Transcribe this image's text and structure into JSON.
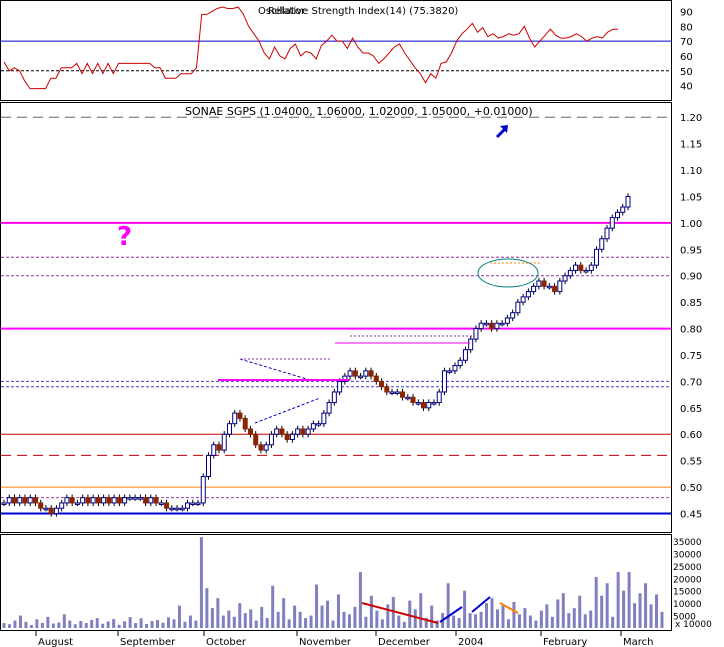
{
  "colors": {
    "background": "#ffffff",
    "grid": "#000000",
    "up_bar": "#000080",
    "down_bar": "#8b2500",
    "rsi_line": "#cc0000",
    "volume": "#8080c0",
    "magenta": "#ff00ff",
    "red": "#cc0000",
    "orange": "#ff8000",
    "blue": "#0000cc"
  },
  "chart_data": [
    {
      "type": "line",
      "name": "rsi-panel",
      "legend_text": "Relative Strength Index(14) (75.3820)",
      "overlay_text": "Oscillator",
      "y_ticks": [
        40,
        50,
        60,
        70,
        80,
        90
      ],
      "ylim": [
        33,
        95
      ],
      "reference_lines": [
        70,
        50
      ],
      "values": [
        56,
        50,
        52,
        50,
        43,
        38,
        38,
        38,
        38,
        45,
        45,
        52,
        52,
        52,
        55,
        48,
        55,
        48,
        55,
        48,
        55,
        48,
        55,
        55,
        55,
        55,
        55,
        55,
        55,
        52,
        52,
        45,
        45,
        45,
        48,
        48,
        48,
        52,
        88,
        88,
        90,
        92,
        93,
        92,
        92,
        93,
        88,
        80,
        75,
        70,
        62,
        58,
        66,
        60,
        58,
        65,
        68,
        60,
        63,
        62,
        58,
        67,
        70,
        74,
        70,
        70,
        65,
        72,
        66,
        62,
        62,
        60,
        55,
        58,
        62,
        66,
        68,
        62,
        57,
        52,
        48,
        42,
        48,
        45,
        55,
        56,
        62,
        70,
        75,
        78,
        82,
        76,
        79,
        73,
        75,
        72,
        73,
        75,
        74,
        75,
        80,
        72,
        66,
        70,
        74,
        78,
        74,
        72,
        72,
        73,
        75,
        73,
        70,
        72,
        73,
        72,
        76,
        78,
        78
      ]
    },
    {
      "type": "candlestick",
      "name": "price-panel",
      "title": "SONAE SGPS (1.04000, 1.06000, 1.02000, 1.05000, +0.01000)",
      "y_ticks": [
        "0.45",
        "0.50",
        "0.55",
        "0.60",
        "0.65",
        "0.70",
        "0.75",
        "0.80",
        "0.85",
        "0.90",
        "0.95",
        "1.00",
        "1.05",
        "1.10",
        "1.15",
        "1.20"
      ],
      "ylim": [
        0.415,
        1.225
      ],
      "x_labels": [
        "August",
        "September",
        "October",
        "November",
        "December",
        "2004",
        "February",
        "March"
      ],
      "horizontal_lines": [
        {
          "value": 1.2,
          "color": "#606060",
          "style": "dashed"
        },
        {
          "value": 1.0,
          "color": "#ff00ff",
          "style": "solid"
        },
        {
          "value": 0.935,
          "color": "#9030a0",
          "style": "dotted"
        },
        {
          "value": 0.9,
          "color": "#9030a0",
          "style": "dotted"
        },
        {
          "value": 0.8,
          "color": "#ff00ff",
          "style": "solid"
        },
        {
          "value": 0.7,
          "color": "#4040c0",
          "style": "dotted"
        },
        {
          "value": 0.69,
          "color": "#4040c0",
          "style": "dotted"
        },
        {
          "value": 0.6,
          "color": "#cc0000",
          "style": "solid"
        },
        {
          "value": 0.56,
          "color": "#cc0000",
          "style": "dashed"
        },
        {
          "value": 0.5,
          "color": "#ff8000",
          "style": "solid"
        },
        {
          "value": 0.48,
          "color": "#a040a0",
          "style": "dotted"
        },
        {
          "value": 0.45,
          "color": "#0000cc",
          "style": "solid"
        }
      ],
      "closes": [
        0.47,
        0.48,
        0.47,
        0.48,
        0.47,
        0.48,
        0.47,
        0.46,
        0.46,
        0.45,
        0.46,
        0.47,
        0.48,
        0.47,
        0.47,
        0.48,
        0.47,
        0.48,
        0.47,
        0.48,
        0.47,
        0.48,
        0.47,
        0.48,
        0.48,
        0.48,
        0.48,
        0.47,
        0.48,
        0.47,
        0.47,
        0.46,
        0.46,
        0.46,
        0.46,
        0.47,
        0.47,
        0.47,
        0.52,
        0.56,
        0.58,
        0.57,
        0.6,
        0.62,
        0.64,
        0.63,
        0.61,
        0.6,
        0.58,
        0.57,
        0.58,
        0.6,
        0.61,
        0.6,
        0.59,
        0.6,
        0.61,
        0.6,
        0.61,
        0.62,
        0.62,
        0.64,
        0.66,
        0.68,
        0.7,
        0.71,
        0.72,
        0.71,
        0.71,
        0.72,
        0.71,
        0.7,
        0.69,
        0.68,
        0.68,
        0.68,
        0.67,
        0.67,
        0.66,
        0.66,
        0.65,
        0.66,
        0.66,
        0.68,
        0.72,
        0.72,
        0.73,
        0.74,
        0.76,
        0.78,
        0.8,
        0.81,
        0.81,
        0.8,
        0.81,
        0.81,
        0.82,
        0.83,
        0.85,
        0.86,
        0.87,
        0.88,
        0.89,
        0.88,
        0.88,
        0.87,
        0.89,
        0.9,
        0.91,
        0.92,
        0.91,
        0.91,
        0.92,
        0.95,
        0.97,
        0.99,
        1.01,
        1.02,
        1.03,
        1.05
      ]
    },
    {
      "type": "bar",
      "name": "volume-panel",
      "y_ticks": [
        "35000",
        "30000",
        "25000",
        "20000",
        "15000",
        "10000",
        "5000"
      ],
      "y_tick_values": [
        35000,
        30000,
        25000,
        20000,
        15000,
        10000,
        5000
      ],
      "multiplier_label": "x 10000",
      "ylim": [
        0,
        37000
      ],
      "values": [
        2000,
        1500,
        3000,
        5000,
        2500,
        1200,
        3500,
        2000,
        4500,
        1800,
        2200,
        5500,
        3000,
        1500,
        2800,
        2000,
        3300,
        4000,
        1700,
        2600,
        3600,
        1300,
        2700,
        4400,
        2000,
        3900,
        1600,
        2800,
        3200,
        2100,
        4300,
        3500,
        9000,
        2500,
        5000,
        3000,
        36500,
        16000,
        8000,
        12000,
        5000,
        7000,
        4500,
        10000,
        6000,
        7500,
        3000,
        8500,
        4000,
        17000,
        6500,
        12000,
        3500,
        9000,
        6500,
        4000,
        5000,
        17500,
        9000,
        11000,
        3000,
        13500,
        6500,
        5500,
        8500,
        22500,
        4500,
        13000,
        7000,
        3500,
        9500,
        12500,
        5000,
        2500,
        11000,
        7500,
        14000,
        4000,
        9000,
        3000,
        6000,
        18000,
        5000,
        4000,
        15000,
        6000,
        5500,
        6500,
        10000,
        12000,
        7500,
        9000,
        3500,
        10500,
        5500,
        8000,
        5000,
        3000,
        7000,
        9500,
        4500,
        11500,
        14000,
        6000,
        8000,
        13000,
        5500,
        7000,
        20500,
        13000,
        18000,
        4500,
        22500,
        15000,
        22500,
        10000,
        14000,
        18000,
        9500,
        13500,
        6500
      ]
    }
  ],
  "annotations": {
    "question_mark": "?",
    "arrow_color": "#0000cc"
  }
}
